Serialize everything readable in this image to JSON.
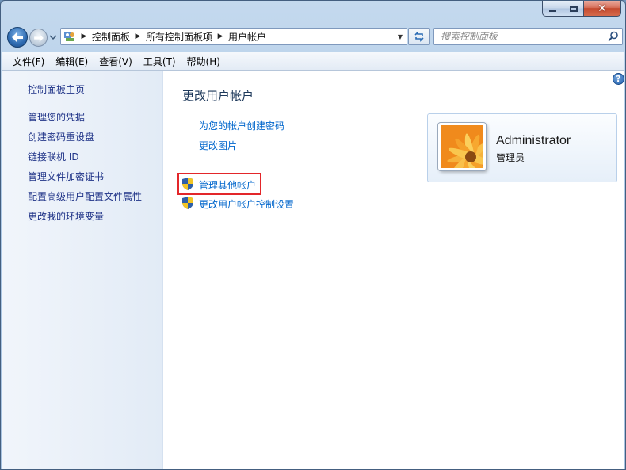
{
  "window": {
    "caption_buttons": {
      "minimize": "minimize",
      "maximize": "maximize",
      "close": "close"
    }
  },
  "address_bar": {
    "icon": "control-panel-icon",
    "breadcrumbs": [
      "控制面板",
      "所有控制面板项",
      "用户帐户"
    ]
  },
  "search": {
    "placeholder": "搜索控制面板"
  },
  "menu": [
    "文件(F)",
    "编辑(E)",
    "查看(V)",
    "工具(T)",
    "帮助(H)"
  ],
  "sidebar": {
    "items": [
      "控制面板主页",
      "管理您的凭据",
      "创建密码重设盘",
      "链接联机 ID",
      "管理文件加密证书",
      "配置高级用户配置文件属性",
      "更改我的环境变量"
    ]
  },
  "main": {
    "title": "更改用户帐户",
    "links": [
      "为您的帐户创建密码",
      "更改图片"
    ],
    "admin_links": [
      "管理其他帐户",
      "更改用户帐户控制设置"
    ],
    "highlight_color": "#e3262a"
  },
  "account": {
    "name": "Administrator",
    "role": "管理员"
  },
  "colors": {
    "link": "#0066cc",
    "sidebar_link": "#1e3287",
    "title": "#1e395b"
  }
}
